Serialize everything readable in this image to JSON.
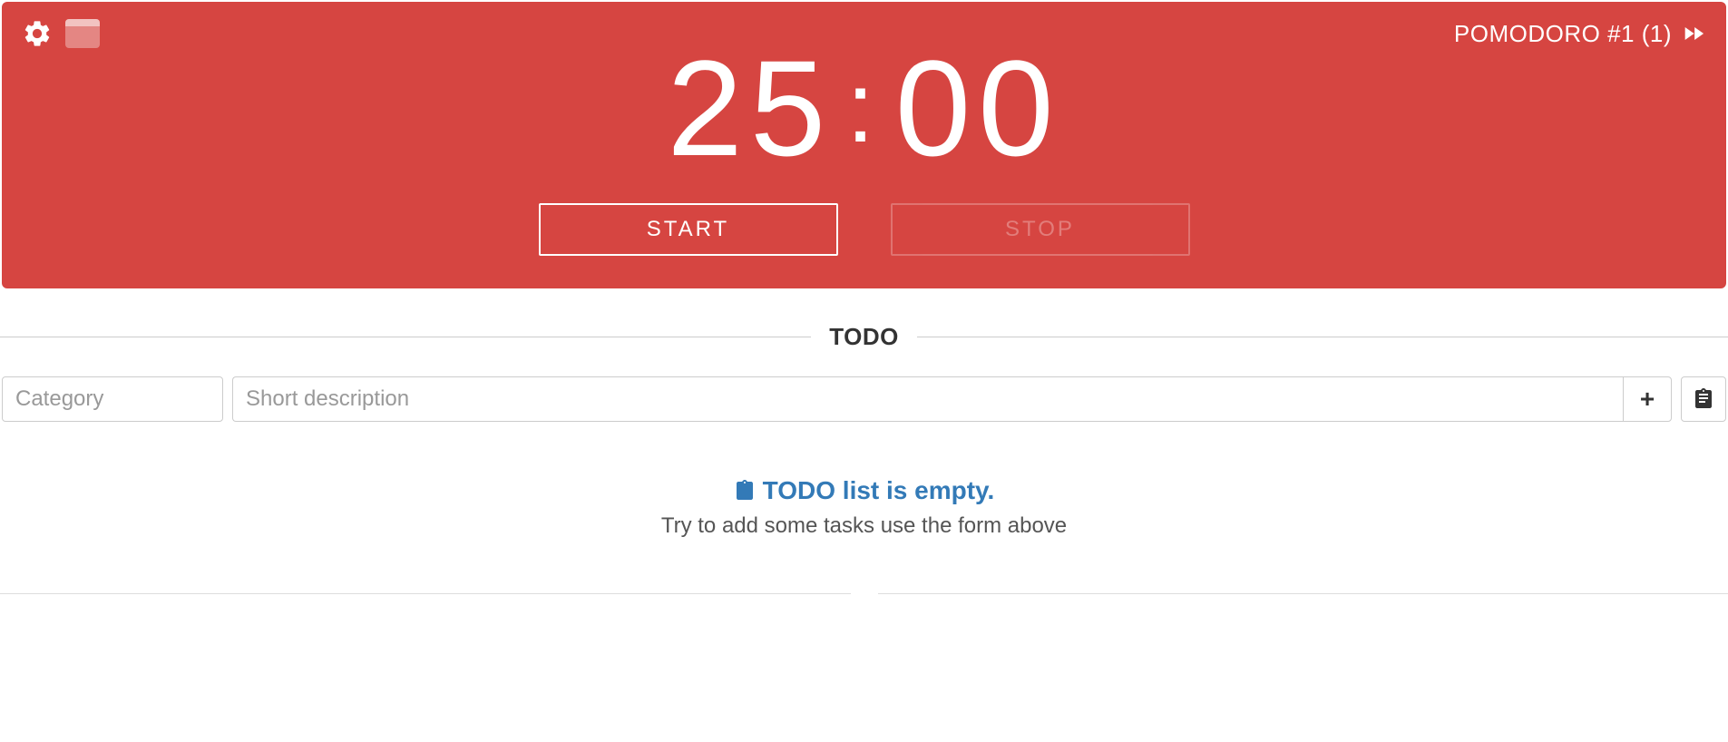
{
  "timer": {
    "session_label": "POMODORO #1 (1)",
    "minutes": "25",
    "separator": ":",
    "seconds": "00",
    "start_label": "START",
    "stop_label": "STOP"
  },
  "todo": {
    "section_title": "TODO",
    "category_placeholder": "Category",
    "description_placeholder": "Short description",
    "empty_title": "TODO list is empty.",
    "empty_subtitle": "Try to add some tasks use the form above"
  }
}
